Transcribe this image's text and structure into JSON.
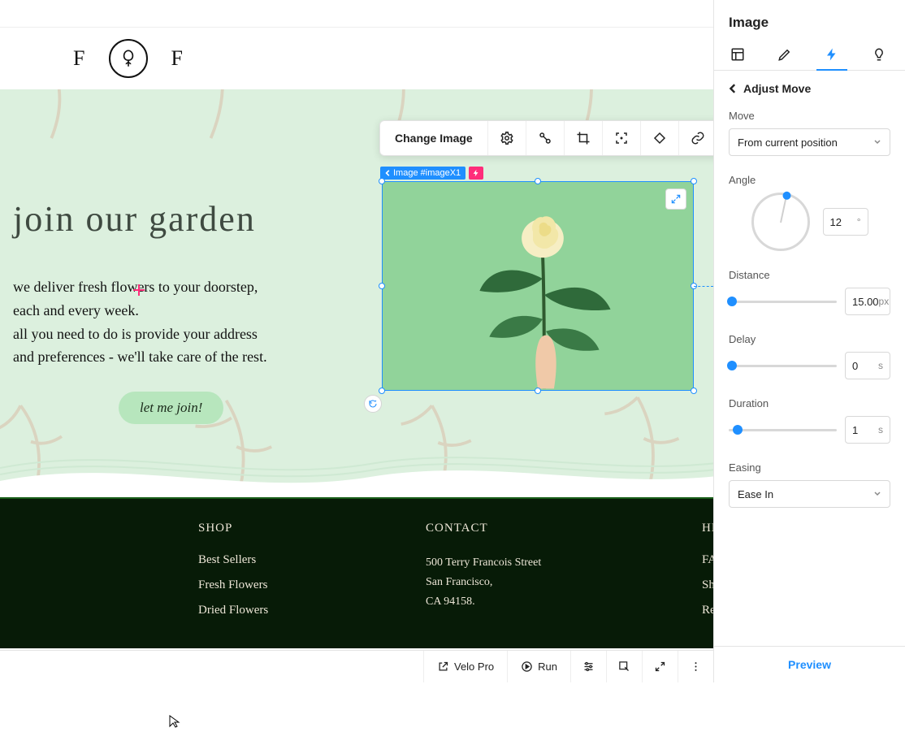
{
  "panel": {
    "title": "Image",
    "back_label": "Adjust Move",
    "preview": "Preview",
    "tabs": [
      "layout",
      "design",
      "animation",
      "idea"
    ],
    "move": {
      "label": "Move",
      "value": "From current position"
    },
    "angle": {
      "label": "Angle",
      "value": "12",
      "unit": "°"
    },
    "distance": {
      "label": "Distance",
      "value": "15.00",
      "unit": "px",
      "thumb_pct": 3
    },
    "delay": {
      "label": "Delay",
      "value": "0",
      "unit": "s",
      "thumb_pct": 3
    },
    "duration": {
      "label": "Duration",
      "value": "1",
      "unit": "s",
      "thumb_pct": 8
    },
    "easing": {
      "label": "Easing",
      "value": "Ease In"
    }
  },
  "toolbar": {
    "change_image": "Change Image"
  },
  "selection": {
    "label": "Image #imageX1"
  },
  "hero": {
    "title": "join our garden",
    "line1": "we deliver fresh flowers to your doorstep,",
    "line2": "each and every week.",
    "line3": "all you need to do is provide your address",
    "line4": "and preferences - we'll take care of the rest.",
    "cta": "let me join!"
  },
  "footer": {
    "shop": {
      "head": "SHOP",
      "items": [
        "Best Sellers",
        "Fresh Flowers",
        "Dried Flowers"
      ]
    },
    "contact": {
      "head": "CONTACT",
      "line1": "500 Terry Francois Street",
      "line2": "San Francisco,",
      "line3": "CA 94158."
    },
    "helpful": {
      "head": "HELPFUL",
      "items": [
        "FAQ",
        "Shipping",
        "Refund Policy"
      ]
    }
  },
  "bottombar": {
    "velo": "Velo Pro",
    "run": "Run"
  },
  "brand": {
    "left": "F",
    "right": "F"
  }
}
